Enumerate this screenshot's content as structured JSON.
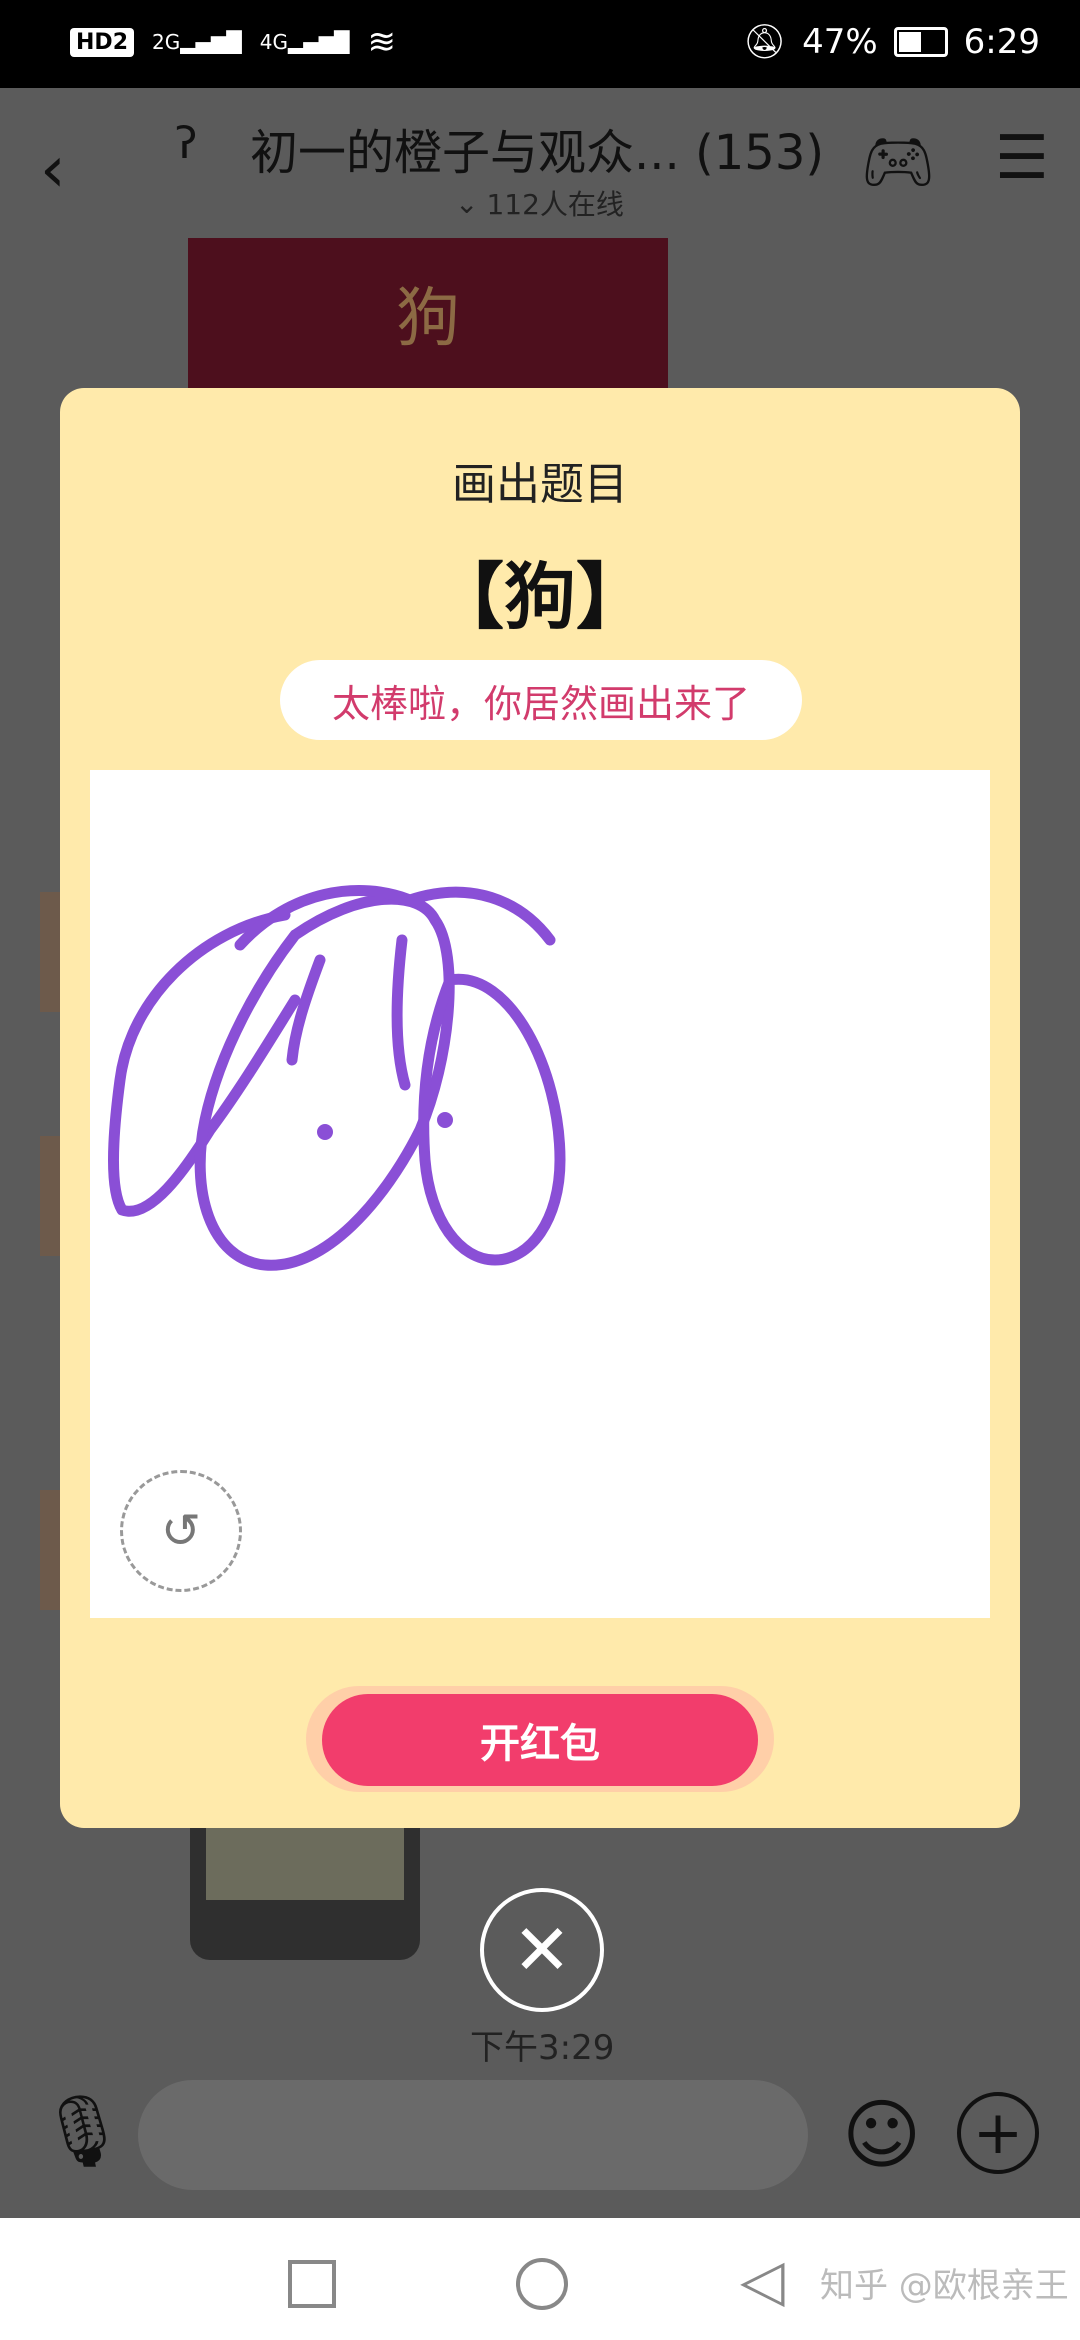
{
  "status_bar": {
    "hd": "HD",
    "hd_sub": "2",
    "sig_2g": "2G",
    "sig_4g": "4G",
    "battery": "47%",
    "time": "6:29"
  },
  "header": {
    "title": "初一的橙子与观众... (153)",
    "online": "112人在线"
  },
  "background": {
    "card_word": "狗",
    "time_label": "下午3:29"
  },
  "modal": {
    "title": "画出题目",
    "prompt": "【狗】",
    "feedback": "太棒啦，你居然画出来了",
    "action_label": "开红包",
    "drawing_color": "#8a4fd6"
  },
  "navbar": {
    "watermark": "知乎 @欧根亲王"
  },
  "colors": {
    "modal_bg": "#ffeaab",
    "action_button": "#f23d6c",
    "feedback_text": "#d23b6c"
  }
}
